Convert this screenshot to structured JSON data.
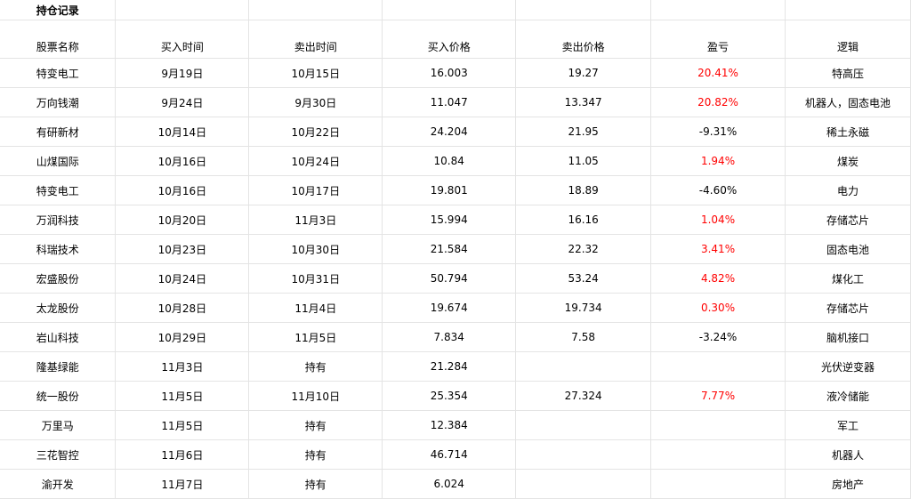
{
  "sheet": {
    "title": "持仓记录",
    "headers": [
      "股票名称",
      "买入时间",
      "卖出时间",
      "买入价格",
      "卖出价格",
      "盈亏",
      "逻辑"
    ],
    "rows": [
      {
        "name": "特变电工",
        "buy_date": "9月19日",
        "sell_date": "10月15日",
        "buy_price": "16.003",
        "sell_price": "19.27",
        "pnl": "20.41%",
        "pnl_positive": true,
        "logic": "特高压"
      },
      {
        "name": "万向钱潮",
        "buy_date": "9月24日",
        "sell_date": "9月30日",
        "buy_price": "11.047",
        "sell_price": "13.347",
        "pnl": "20.82%",
        "pnl_positive": true,
        "logic": "机器人，固态电池"
      },
      {
        "name": "有研新材",
        "buy_date": "10月14日",
        "sell_date": "10月22日",
        "buy_price": "24.204",
        "sell_price": "21.95",
        "pnl": "-9.31%",
        "pnl_positive": false,
        "logic": "稀土永磁"
      },
      {
        "name": "山煤国际",
        "buy_date": "10月16日",
        "sell_date": "10月24日",
        "buy_price": "10.84",
        "sell_price": "11.05",
        "pnl": "1.94%",
        "pnl_positive": true,
        "logic": "煤炭"
      },
      {
        "name": "特变电工",
        "buy_date": "10月16日",
        "sell_date": "10月17日",
        "buy_price": "19.801",
        "sell_price": "18.89",
        "pnl": "-4.60%",
        "pnl_positive": false,
        "logic": "电力"
      },
      {
        "name": "万润科技",
        "buy_date": "10月20日",
        "sell_date": "11月3日",
        "buy_price": "15.994",
        "sell_price": "16.16",
        "pnl": "1.04%",
        "pnl_positive": true,
        "logic": "存储芯片"
      },
      {
        "name": "科瑞技术",
        "buy_date": "10月23日",
        "sell_date": "10月30日",
        "buy_price": "21.584",
        "sell_price": "22.32",
        "pnl": "3.41%",
        "pnl_positive": true,
        "logic": "固态电池"
      },
      {
        "name": "宏盛股份",
        "buy_date": "10月24日",
        "sell_date": "10月31日",
        "buy_price": "50.794",
        "sell_price": "53.24",
        "pnl": "4.82%",
        "pnl_positive": true,
        "logic": "煤化工"
      },
      {
        "name": "太龙股份",
        "buy_date": "10月28日",
        "sell_date": "11月4日",
        "buy_price": "19.674",
        "sell_price": "19.734",
        "pnl": "0.30%",
        "pnl_positive": true,
        "logic": "存储芯片"
      },
      {
        "name": "岩山科技",
        "buy_date": "10月29日",
        "sell_date": "11月5日",
        "buy_price": "7.834",
        "sell_price": "7.58",
        "pnl": "-3.24%",
        "pnl_positive": false,
        "logic": "脑机接口"
      },
      {
        "name": "隆基绿能",
        "buy_date": "11月3日",
        "sell_date": "持有",
        "buy_price": "21.284",
        "sell_price": "",
        "pnl": "",
        "pnl_positive": true,
        "logic": "光伏逆变器"
      },
      {
        "name": "统一股份",
        "buy_date": "11月5日",
        "sell_date": "11月10日",
        "buy_price": "25.354",
        "sell_price": "27.324",
        "pnl": "7.77%",
        "pnl_positive": true,
        "logic": "液冷储能"
      },
      {
        "name": "万里马",
        "buy_date": "11月5日",
        "sell_date": "持有",
        "buy_price": "12.384",
        "sell_price": "",
        "pnl": "",
        "pnl_positive": true,
        "logic": "军工"
      },
      {
        "name": "三花智控",
        "buy_date": "11月6日",
        "sell_date": "持有",
        "buy_price": "46.714",
        "sell_price": "",
        "pnl": "",
        "pnl_positive": true,
        "logic": "机器人"
      },
      {
        "name": "渝开发",
        "buy_date": "11月7日",
        "sell_date": "持有",
        "buy_price": "6.024",
        "sell_price": "",
        "pnl": "",
        "pnl_positive": true,
        "logic": "房地产"
      }
    ]
  },
  "colors": {
    "positive": "#ff0000",
    "negative": "#000000",
    "grid": "#e4e4e4"
  }
}
